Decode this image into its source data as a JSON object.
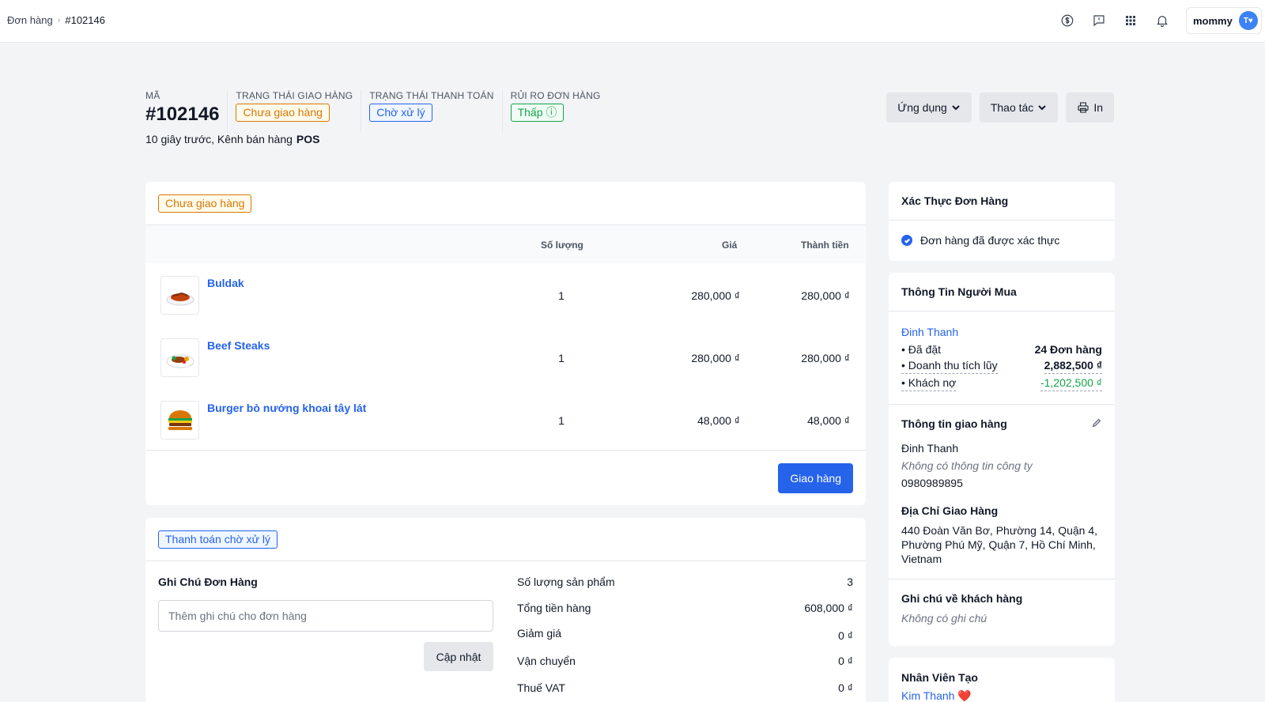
{
  "breadcrumb": {
    "parent": "Đơn hàng",
    "current": "#102146"
  },
  "user": {
    "name": "mommy",
    "initials": "T♥"
  },
  "icons": [
    "currency-icon",
    "feedback-icon",
    "apps-grid-icon",
    "bell-icon"
  ],
  "header": {
    "code_label": "MÃ",
    "code": "#102146",
    "sub_time": "10 giây trước, Kênh bán hàng",
    "sub_channel": "POS",
    "shipping_label": "TRẠNG THÁI GIAO HÀNG",
    "shipping_status": "Chưa giao hàng",
    "payment_label": "TRẠNG THÁI THANH TOÁN",
    "payment_status": "Chờ xử lý",
    "risk_label": "RỦI RO ĐƠN HÀNG",
    "risk_status": "Thấp ⓘ",
    "actions": {
      "apps": "Ứng dụng",
      "operations": "Thao tác",
      "print": "In"
    }
  },
  "products_card": {
    "badge": "Chưa giao hàng",
    "columns": {
      "qty": "Số lượng",
      "price": "Giá",
      "total": "Thành tiền"
    },
    "items": [
      {
        "name": "Buldak",
        "qty": "1",
        "price": "280,000 ₫",
        "total": "280,000 ₫"
      },
      {
        "name": "Beef Steaks",
        "qty": "1",
        "price": "280,000 ₫",
        "total": "280,000 ₫"
      },
      {
        "name": "Burger bò nướng khoai tây lát",
        "qty": "1",
        "price": "48,000 ₫",
        "total": "48,000 ₫"
      }
    ],
    "ship_button": "Giao hàng"
  },
  "payment_card": {
    "badge": "Thanh toán chờ xử lý",
    "note_title": "Ghi Chú Đơn Hàng",
    "note_placeholder": "Thêm ghi chú cho đơn hàng",
    "update_button": "Cập nhật",
    "summary": [
      {
        "label": "Số lượng sản phẩm",
        "value": "3"
      },
      {
        "label": "Tổng tiền hàng",
        "value": "608,000 ₫"
      },
      {
        "label": "Giảm giá",
        "value": "0 ₫"
      },
      {
        "label": "Vận chuyển",
        "value": "0 ₫"
      },
      {
        "label": "Thuế VAT",
        "value": "0 ₫"
      }
    ]
  },
  "verify_card": {
    "title": "Xác Thực Đơn Hàng",
    "text": "Đơn hàng đã được xác thực"
  },
  "buyer_card": {
    "title": "Thông Tin Người Mua",
    "name": "Đinh Thanh",
    "stats": [
      {
        "label": "• Đã đặt",
        "value": "24 Đơn hàng"
      },
      {
        "label": "• Doanh thu tích lũy",
        "value": "2,882,500 ₫"
      },
      {
        "label": "• Khách nợ",
        "value": "-1,202,500 ₫"
      }
    ],
    "shipping_title": "Thông tin giao hàng",
    "ship_name": "Đinh Thanh",
    "ship_company": "Không có thông tin công ty",
    "ship_phone": "0980989895",
    "address_title": "Địa Chỉ Giao Hàng",
    "address": "440 Đoàn Văn Bơ, Phường 14, Quận 4, Phường Phú Mỹ, Quận 7, Hồ Chí Minh, Vietnam",
    "customer_note_title": "Ghi chú về khách hàng",
    "customer_note": "Không có ghi chú"
  },
  "staff_card": {
    "title": "Nhân Viên Tạo",
    "name": "Kim Thanh ❤️"
  }
}
